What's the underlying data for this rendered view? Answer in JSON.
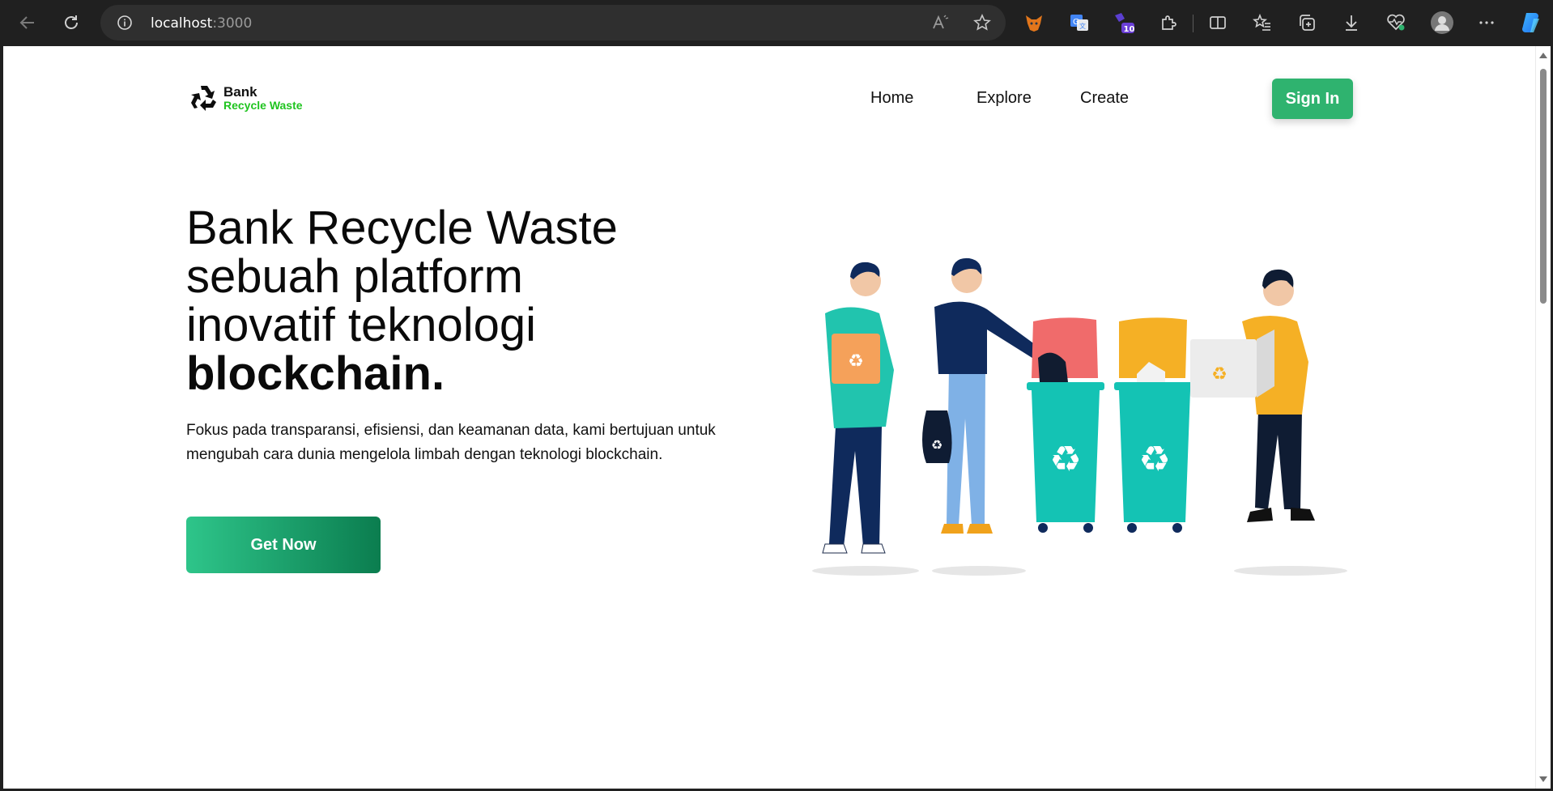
{
  "browser": {
    "url_host": "localhost",
    "url_port": ":3000",
    "extension_badge": "10"
  },
  "site": {
    "logo_line1": "Bank",
    "logo_line2": "Recycle Waste",
    "nav": [
      "Home",
      "Explore",
      "Create"
    ],
    "signin_label": "Sign In"
  },
  "hero": {
    "title_lines": [
      "Bank Recycle Waste",
      "sebuah platform",
      "inovatif teknologi"
    ],
    "title_bold": "blockchain.",
    "subtitle": "Fokus pada transparansi, efisiensi, dan keamanan data, kami bertujuan untuk mengubah cara dunia mengelola limbah dengan teknologi blockchain.",
    "cta_label": "Get Now"
  },
  "colors": {
    "accent": "#2fb36f",
    "logo_green": "#1fc41f",
    "cta_start": "#2ec58a",
    "cta_end": "#0b7d4f",
    "bin_teal": "#14c3b4"
  },
  "icons": [
    "back-icon",
    "refresh-icon",
    "info-icon",
    "read-aloud-icon",
    "favorite-star-icon",
    "fox-extension-icon",
    "translate-extension-icon",
    "calendar-extension-icon",
    "extensions-puzzle-icon",
    "split-screen-icon",
    "favorites-icon",
    "collections-icon",
    "downloads-icon",
    "health-icon",
    "profile-avatar-icon",
    "more-icon",
    "copilot-icon",
    "recycle-logo-icon"
  ]
}
